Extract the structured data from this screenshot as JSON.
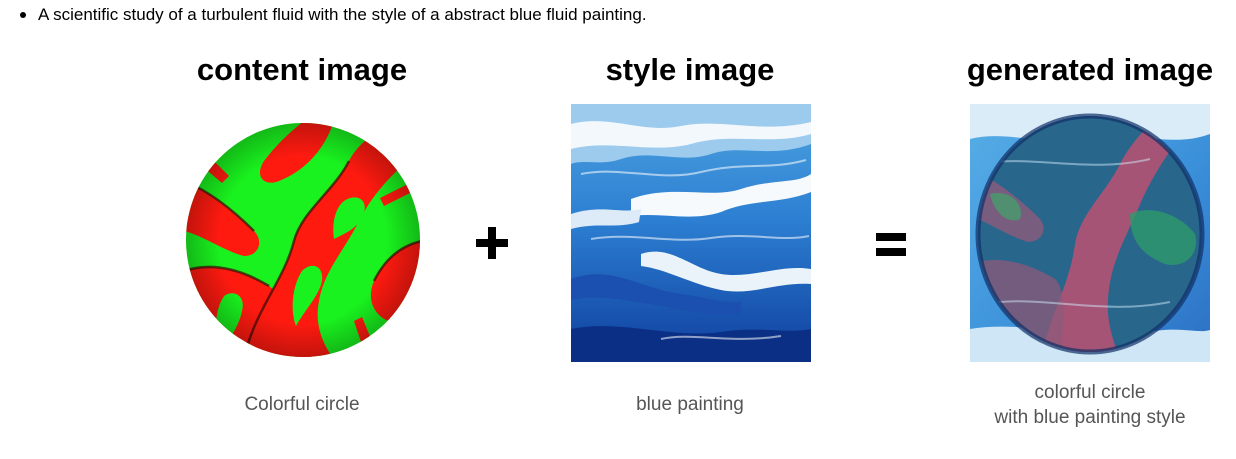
{
  "intro": {
    "text": "A scientific study of a turbulent fluid with the style of a abstract blue fluid painting."
  },
  "panels": {
    "content": {
      "title": "content image",
      "caption": "Colorful circle"
    },
    "style": {
      "title": "style image",
      "caption": "blue painting"
    },
    "generated": {
      "title": "generated image",
      "caption_line1": "colorful circle",
      "caption_line2": "with blue painting style"
    }
  },
  "operators": {
    "plus": "+",
    "equals": "="
  },
  "colors": {
    "content_red": "#ff1a10",
    "content_green": "#19f21e",
    "style_blue": "#1a5fc4",
    "style_light": "#e9f3fb",
    "generated_pink": "#b04f7a"
  }
}
